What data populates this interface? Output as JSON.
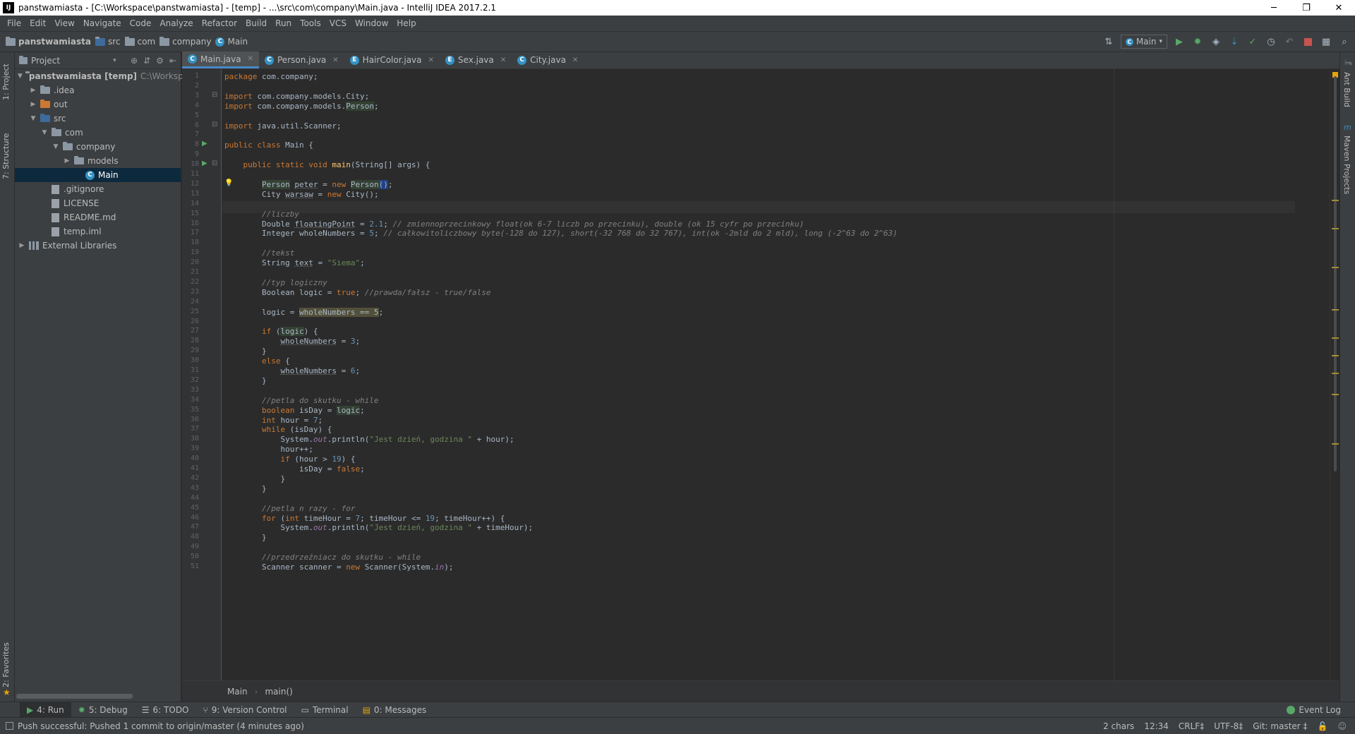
{
  "window": {
    "title": "panstwamiasta - [C:\\Workspace\\panstwamiasta] - [temp] - ...\\src\\com\\company\\Main.java - IntelliJ IDEA 2017.2.1",
    "minimize": "─",
    "maximize": "❐",
    "close": "✕"
  },
  "menu": [
    "File",
    "Edit",
    "View",
    "Navigate",
    "Code",
    "Analyze",
    "Refactor",
    "Build",
    "Run",
    "Tools",
    "VCS",
    "Window",
    "Help"
  ],
  "breadcrumb": {
    "project": "panstwamiasta",
    "src": "src",
    "com": "com",
    "company": "company",
    "main": "Main"
  },
  "run_config": "Main",
  "left_tabs": {
    "project": "1: Project",
    "structure": "7: Structure",
    "favorites": "2: Favorites"
  },
  "right_tabs": {
    "ant": "Ant Build",
    "maven": "Maven Projects"
  },
  "project_panel": {
    "title": "Project",
    "tree": [
      {
        "label": "panstwamiasta [temp]",
        "extra": "C:\\Workspac",
        "level": 0,
        "expanded": true,
        "kind": "module"
      },
      {
        "label": ".idea",
        "level": 1,
        "expanded": false,
        "kind": "folder"
      },
      {
        "label": "out",
        "level": 1,
        "expanded": false,
        "kind": "folder-orange"
      },
      {
        "label": "src",
        "level": 1,
        "expanded": true,
        "kind": "folder-blue"
      },
      {
        "label": "com",
        "level": 2,
        "expanded": true,
        "kind": "folder"
      },
      {
        "label": "company",
        "level": 3,
        "expanded": true,
        "kind": "folder"
      },
      {
        "label": "models",
        "level": 4,
        "expanded": false,
        "kind": "folder"
      },
      {
        "label": "Main",
        "level": 5,
        "kind": "class",
        "selected": true
      },
      {
        "label": ".gitignore",
        "level": 2,
        "kind": "file"
      },
      {
        "label": "LICENSE",
        "level": 2,
        "kind": "file"
      },
      {
        "label": "README.md",
        "level": 2,
        "kind": "file"
      },
      {
        "label": "temp.iml",
        "level": 2,
        "kind": "file"
      },
      {
        "label": "External Libraries",
        "level": 0,
        "expanded": false,
        "kind": "library"
      }
    ]
  },
  "tabs": [
    {
      "label": "Main.java",
      "kind": "C",
      "active": true
    },
    {
      "label": "Person.java",
      "kind": "C"
    },
    {
      "label": "HairColor.java",
      "kind": "E"
    },
    {
      "label": "Sex.java",
      "kind": "E"
    },
    {
      "label": "City.java",
      "kind": "C"
    }
  ],
  "code": [
    [
      {
        "t": "package ",
        "c": "kw"
      },
      {
        "t": "com.company;"
      }
    ],
    [],
    [
      {
        "t": "import ",
        "c": "kw"
      },
      {
        "t": "com.company.models.City;"
      }
    ],
    [
      {
        "t": "import ",
        "c": "kw"
      },
      {
        "t": "com.company.models."
      },
      {
        "t": "Person",
        "c": "hl"
      },
      {
        "t": ";"
      }
    ],
    [],
    [
      {
        "t": "import ",
        "c": "kw"
      },
      {
        "t": "java.util.Scanner;"
      }
    ],
    [],
    [
      {
        "t": "public class ",
        "c": "kw"
      },
      {
        "t": "Main {"
      }
    ],
    [],
    [
      {
        "t": "    "
      },
      {
        "t": "public static void ",
        "c": "kw"
      },
      {
        "t": "main",
        "c": "fn"
      },
      {
        "t": "(String[] args) {"
      }
    ],
    [],
    [
      {
        "t": "        "
      },
      {
        "t": "Person",
        "c": "hl"
      },
      {
        "t": " "
      },
      {
        "t": "peter",
        "c": "unused"
      },
      {
        "t": " = "
      },
      {
        "t": "new ",
        "c": "kw"
      },
      {
        "t": "Person",
        "c": "hl"
      },
      {
        "t": "()",
        "c": "sel"
      },
      {
        "t": ";"
      }
    ],
    [
      {
        "t": "        City "
      },
      {
        "t": "warsaw",
        "c": "unused"
      },
      {
        "t": " = "
      },
      {
        "t": "new ",
        "c": "kw"
      },
      {
        "t": "City();"
      }
    ],
    [],
    [
      {
        "t": "        "
      },
      {
        "t": "//liczby",
        "c": "cm"
      }
    ],
    [
      {
        "t": "        Double "
      },
      {
        "t": "floatingPoint",
        "c": "unused"
      },
      {
        "t": " = "
      },
      {
        "t": "2.1",
        "c": "num"
      },
      {
        "t": "; "
      },
      {
        "t": "// zmiennoprzecinkowy float(ok 6-7 liczb po przecinku), double (ok 15 cyfr po przecinku)",
        "c": "cm"
      }
    ],
    [
      {
        "t": "        Integer wholeNumbers = "
      },
      {
        "t": "5",
        "c": "num"
      },
      {
        "t": "; "
      },
      {
        "t": "// całkowitoliczbowy byte(-128 do 127), short(-32 768 do 32 767), int(ok -2mld do 2 mld), long (-2^63 do 2^63)",
        "c": "cm"
      }
    ],
    [],
    [
      {
        "t": "        "
      },
      {
        "t": "//tekst",
        "c": "cm"
      }
    ],
    [
      {
        "t": "        String "
      },
      {
        "t": "text",
        "c": "unused"
      },
      {
        "t": " = "
      },
      {
        "t": "\"Siema\"",
        "c": "str"
      },
      {
        "t": ";"
      }
    ],
    [],
    [
      {
        "t": "        "
      },
      {
        "t": "//typ logiczny",
        "c": "cm"
      }
    ],
    [
      {
        "t": "        Boolean logic = "
      },
      {
        "t": "true",
        "c": "kw"
      },
      {
        "t": "; "
      },
      {
        "t": "//prawda/fałsz - true/false",
        "c": "cm"
      }
    ],
    [],
    [
      {
        "t": "        logic = "
      },
      {
        "t": "wholeNumbers == 5",
        "c": "warn"
      },
      {
        "t": ";"
      }
    ],
    [],
    [
      {
        "t": "        "
      },
      {
        "t": "if ",
        "c": "kw"
      },
      {
        "t": "("
      },
      {
        "t": "logic",
        "c": "hl"
      },
      {
        "t": ") {"
      }
    ],
    [
      {
        "t": "            "
      },
      {
        "t": "wholeNumbers",
        "c": "unused"
      },
      {
        "t": " = "
      },
      {
        "t": "3",
        "c": "num"
      },
      {
        "t": ";"
      }
    ],
    [
      {
        "t": "        }"
      }
    ],
    [
      {
        "t": "        "
      },
      {
        "t": "else ",
        "c": "kw"
      },
      {
        "t": "{"
      }
    ],
    [
      {
        "t": "            "
      },
      {
        "t": "wholeNumbers",
        "c": "unused"
      },
      {
        "t": " = "
      },
      {
        "t": "6",
        "c": "num"
      },
      {
        "t": ";"
      }
    ],
    [
      {
        "t": "        }"
      }
    ],
    [],
    [
      {
        "t": "        "
      },
      {
        "t": "//petla do skutku - while",
        "c": "cm"
      }
    ],
    [
      {
        "t": "        "
      },
      {
        "t": "boolean ",
        "c": "kw"
      },
      {
        "t": "isDay = "
      },
      {
        "t": "logic",
        "c": "hl"
      },
      {
        "t": ";"
      }
    ],
    [
      {
        "t": "        "
      },
      {
        "t": "int ",
        "c": "kw"
      },
      {
        "t": "hour = "
      },
      {
        "t": "7",
        "c": "num"
      },
      {
        "t": ";"
      }
    ],
    [
      {
        "t": "        "
      },
      {
        "t": "while ",
        "c": "kw"
      },
      {
        "t": "(isDay) {"
      }
    ],
    [
      {
        "t": "            System."
      },
      {
        "t": "out",
        "c": "field"
      },
      {
        "t": ".println("
      },
      {
        "t": "\"Jest dzień, godzina \"",
        "c": "str"
      },
      {
        "t": " + hour);"
      }
    ],
    [
      {
        "t": "            hour++;"
      }
    ],
    [
      {
        "t": "            "
      },
      {
        "t": "if ",
        "c": "kw"
      },
      {
        "t": "(hour > "
      },
      {
        "t": "19",
        "c": "num"
      },
      {
        "t": ") {"
      }
    ],
    [
      {
        "t": "                isDay = "
      },
      {
        "t": "false",
        "c": "kw"
      },
      {
        "t": ";"
      }
    ],
    [
      {
        "t": "            }"
      }
    ],
    [
      {
        "t": "        }"
      }
    ],
    [],
    [
      {
        "t": "        "
      },
      {
        "t": "//petla n razy - for",
        "c": "cm"
      }
    ],
    [
      {
        "t": "        "
      },
      {
        "t": "for ",
        "c": "kw"
      },
      {
        "t": "("
      },
      {
        "t": "int ",
        "c": "kw"
      },
      {
        "t": "timeHour = "
      },
      {
        "t": "7",
        "c": "num"
      },
      {
        "t": "; timeHour <= "
      },
      {
        "t": "19",
        "c": "num"
      },
      {
        "t": "; timeHour++) {"
      }
    ],
    [
      {
        "t": "            System."
      },
      {
        "t": "out",
        "c": "field"
      },
      {
        "t": ".println("
      },
      {
        "t": "\"Jest dzień, godzina \"",
        "c": "str"
      },
      {
        "t": " + timeHour);"
      }
    ],
    [
      {
        "t": "        }"
      }
    ],
    [],
    [
      {
        "t": "        "
      },
      {
        "t": "//przedrzeźniacz do skutku - while",
        "c": "cm"
      }
    ],
    [
      {
        "t": "        Scanner scanner = "
      },
      {
        "t": "new ",
        "c": "kw"
      },
      {
        "t": "Scanner(System."
      },
      {
        "t": "in",
        "c": "field"
      },
      {
        "t": ");"
      }
    ]
  ],
  "syntax_colors": {
    "kw": "#cc7832",
    "str": "#6a8759",
    "num": "#6897bb",
    "cm": "#808080",
    "fn": "#ffc66d",
    "field": "#9876aa",
    "unused": "#a9b7c6",
    "text": "#a9b7c6"
  },
  "editor_breadcrumb": {
    "cls": "Main",
    "method": "main()"
  },
  "bottom_tools": [
    {
      "label": "4: Run",
      "icon": "run-icon",
      "active": true
    },
    {
      "label": "5: Debug",
      "icon": "debug-icon"
    },
    {
      "label": "6: TODO",
      "icon": "todo-icon"
    },
    {
      "label": "9: Version Control",
      "icon": "vcs-icon"
    },
    {
      "label": "Terminal",
      "icon": "terminal-icon"
    },
    {
      "label": "0: Messages",
      "icon": "messages-icon"
    }
  ],
  "event_log": "Event Log",
  "status": {
    "message": "Push successful: Pushed 1 commit to origin/master (4 minutes ago)",
    "chars": "2 chars",
    "position": "12:34",
    "line_sep": "CRLF‡",
    "encoding": "UTF-8‡",
    "git": "Git: master ‡"
  }
}
